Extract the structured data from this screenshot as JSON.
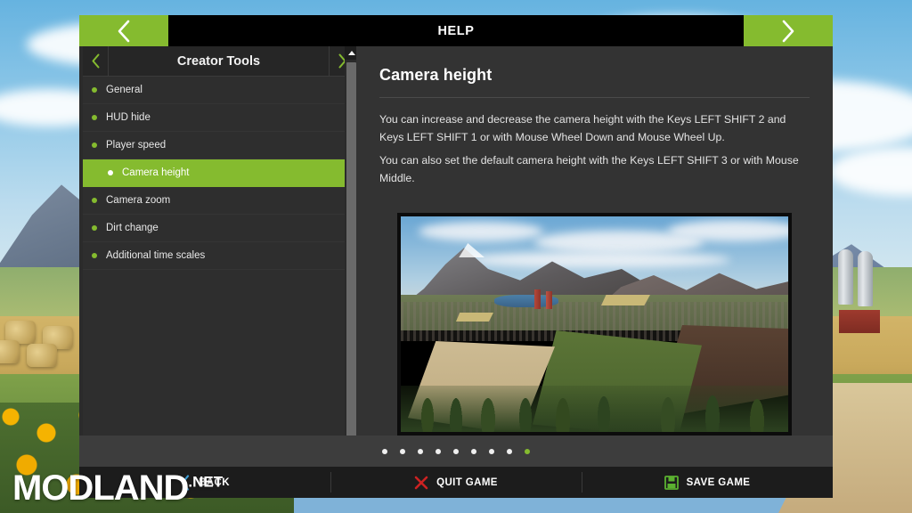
{
  "window": {
    "title": "HELP",
    "prev_icon": "chevron-left-icon",
    "next_icon": "chevron-right-icon"
  },
  "sidebar": {
    "title": "Creator Tools",
    "prev_icon": "chevron-left-icon",
    "next_icon": "chevron-right-icon",
    "scroll_up_icon": "triangle-up-icon",
    "scroll_down_icon": "triangle-down-icon",
    "items": [
      {
        "label": "General",
        "selected": false,
        "indent": false
      },
      {
        "label": "HUD hide",
        "selected": false,
        "indent": false
      },
      {
        "label": "Player speed",
        "selected": false,
        "indent": false
      },
      {
        "label": "Camera height",
        "selected": true,
        "indent": true
      },
      {
        "label": "Camera zoom",
        "selected": false,
        "indent": false
      },
      {
        "label": "Dirt change",
        "selected": false,
        "indent": false
      },
      {
        "label": "Additional time scales",
        "selected": false,
        "indent": false
      }
    ]
  },
  "content": {
    "heading": "Camera height",
    "paragraph1": "You can increase and decrease the camera height with the Keys LEFT SHIFT 2 and Keys LEFT SHIFT 1 or with Mouse Wheel Down and Mouse Wheel Up.",
    "paragraph2": "You can also set the default camera height with the Keys LEFT SHIFT 3 or with Mouse Middle.",
    "image_alt": "In-game aerial view of farmland with mountains, fields and a town"
  },
  "pager": {
    "total": 9,
    "active_index": 8
  },
  "bottom_bar": {
    "buttons": [
      {
        "label": "BACK",
        "icon": "chevron-left-icon",
        "icon_color": "#3d9fd6"
      },
      {
        "label": "QUIT GAME",
        "icon": "cross-icon",
        "icon_color": "#cc2222"
      },
      {
        "label": "SAVE GAME",
        "icon": "floppy-disk-icon",
        "icon_color": "#5bb130"
      }
    ]
  },
  "watermark": {
    "main": "MODLAND",
    "suffix": ".NET"
  },
  "colors": {
    "accent_green": "#85bb2f",
    "panel_dark": "#2e2e2e",
    "content_bg": "#333333",
    "title_bar": "#000000",
    "bottom_bar": "#1c1c1c"
  }
}
